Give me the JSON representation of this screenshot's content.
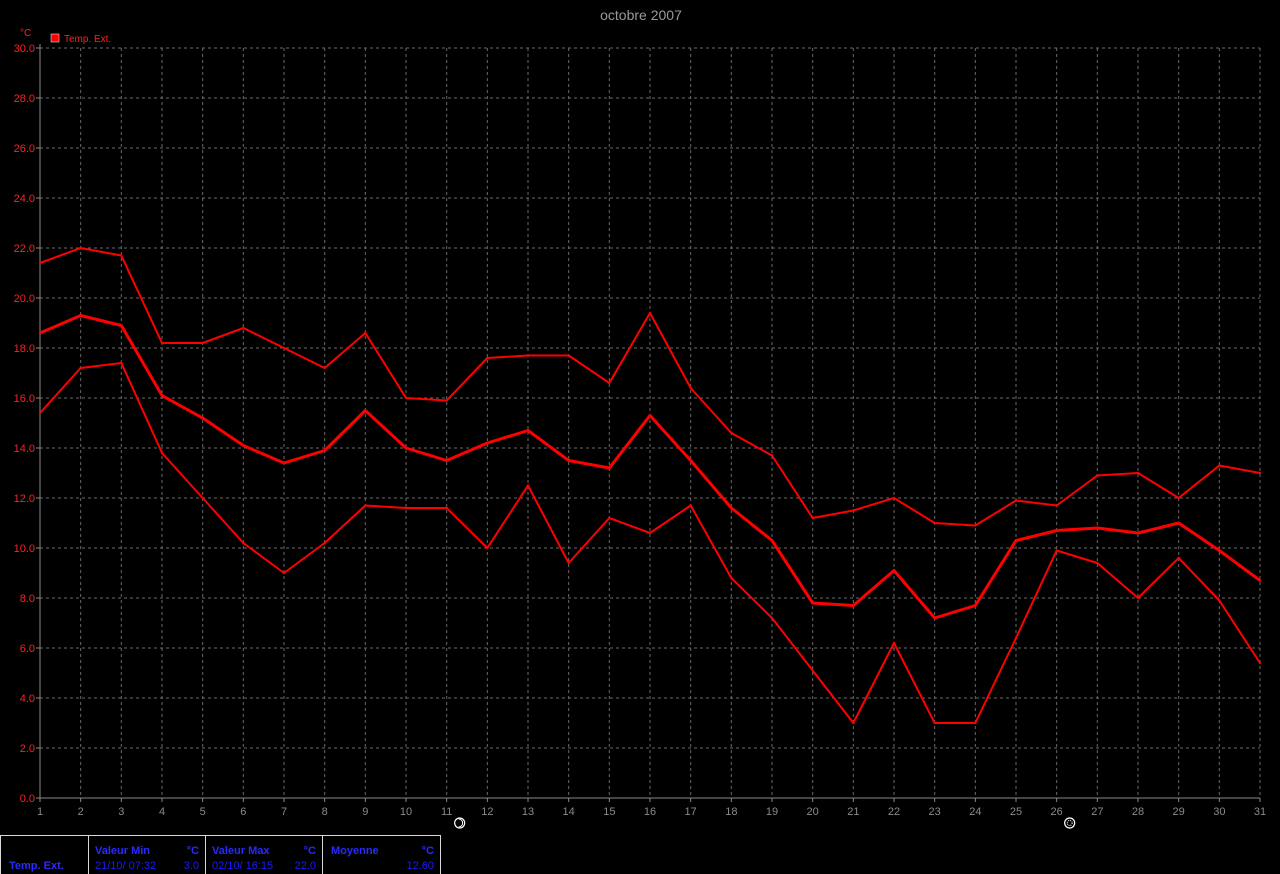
{
  "chart_data": {
    "type": "line",
    "title": "octobre 2007",
    "ylabel": "°C",
    "ylim": [
      0,
      30
    ],
    "xlim": [
      1,
      31
    ],
    "grid": true,
    "legend_position": "top-left",
    "legend": [
      "Temp. Ext."
    ],
    "x": [
      1,
      2,
      3,
      4,
      5,
      6,
      7,
      8,
      9,
      10,
      11,
      12,
      13,
      14,
      15,
      16,
      17,
      18,
      19,
      20,
      21,
      22,
      23,
      24,
      25,
      26,
      27,
      28,
      29,
      30,
      31
    ],
    "y_ticks": [
      "0.0",
      "2.0",
      "4.0",
      "6.0",
      "8.0",
      "10.0",
      "12.0",
      "14.0",
      "16.0",
      "18.0",
      "20.0",
      "22.0",
      "24.0",
      "26.0",
      "28.0",
      "30.0"
    ],
    "series": [
      {
        "role": "max",
        "values": [
          21.4,
          22.0,
          21.7,
          18.2,
          18.2,
          18.8,
          18.0,
          17.2,
          18.6,
          16.0,
          15.9,
          17.6,
          17.7,
          17.7,
          16.6,
          19.4,
          16.4,
          14.6,
          13.7,
          11.2,
          11.5,
          12.0,
          11.0,
          10.9,
          11.9,
          11.7,
          12.9,
          13.0,
          12.0,
          13.3,
          13.0
        ]
      },
      {
        "role": "mean",
        "values": [
          18.6,
          19.3,
          18.9,
          16.1,
          15.2,
          14.1,
          13.4,
          13.9,
          15.5,
          14.0,
          13.5,
          14.2,
          14.7,
          13.5,
          13.2,
          15.3,
          13.5,
          11.6,
          10.3,
          7.8,
          7.7,
          9.1,
          7.2,
          7.7,
          10.3,
          10.7,
          10.8,
          10.6,
          11.0,
          9.9,
          8.7
        ]
      },
      {
        "role": "min",
        "values": [
          15.4,
          17.2,
          17.4,
          13.8,
          12.0,
          10.2,
          9.0,
          10.2,
          11.7,
          11.6,
          11.6,
          10.0,
          12.5,
          9.4,
          11.2,
          10.6,
          11.7,
          8.8,
          7.2,
          5.1,
          3.0,
          6.2,
          3.0,
          3.0,
          6.4,
          9.9,
          9.4,
          8.0,
          9.6,
          7.9,
          5.4
        ]
      }
    ],
    "moon_phases": [
      {
        "day": 11,
        "phase": "new-moon"
      },
      {
        "day": 26,
        "phase": "full-moon"
      }
    ],
    "colors": {
      "series": "#ff0000",
      "axis_text": "#ff2020",
      "grid": "#6a6a6a",
      "axis": "#8a8a8a",
      "title": "#9a9a9a",
      "background": "#000000"
    }
  },
  "stats": {
    "row_label": "Temp. Ext.",
    "min": {
      "label": "Valeur Min",
      "unit": "°C",
      "date": "21/10/ 07:32",
      "value": "3.0"
    },
    "max": {
      "label": "Valeur Max",
      "unit": "°C",
      "date": "02/10/ 16:15",
      "value": "22.0"
    },
    "mean": {
      "label": "Moyenne",
      "unit": "°C",
      "value": "12.60"
    }
  }
}
